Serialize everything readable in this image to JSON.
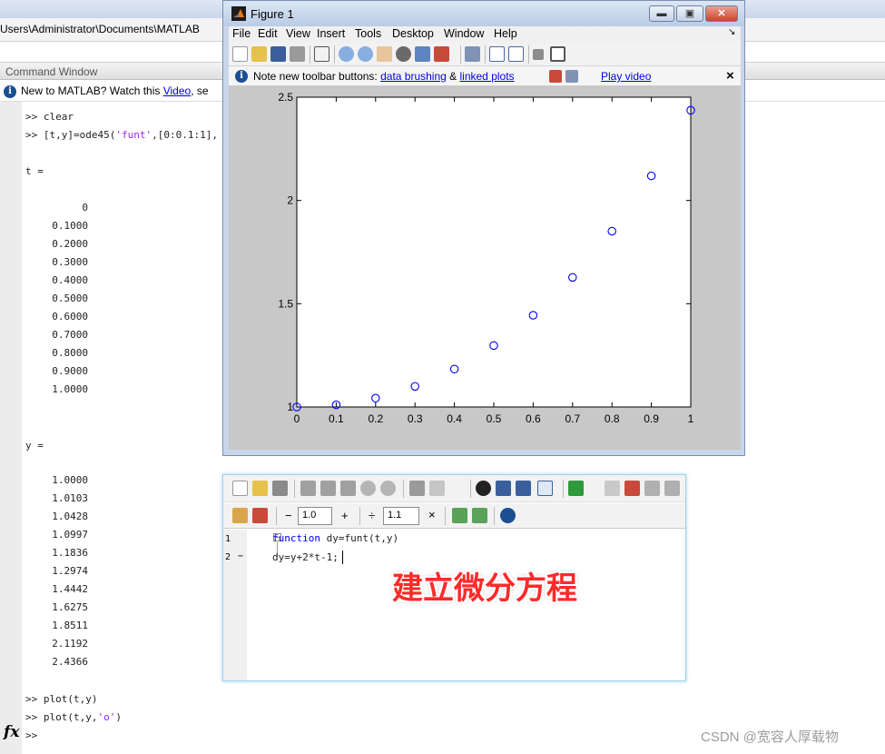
{
  "matlab": {
    "path": "Users\\Administrator\\Documents\\MATLAB",
    "command_window_title": "Command Window",
    "notice": {
      "prefix": "New to MATLAB? Watch this ",
      "link": "Video",
      "suffix": ", se"
    },
    "lines": {
      "l1": ">> clear",
      "l2_prompt": ">> [t,y]=ode45(",
      "l2_str": "'funt'",
      "l2_rest": ",[0:0.1:1],",
      "t_label": "t =",
      "t_values": [
        "0",
        "0.1000",
        "0.2000",
        "0.3000",
        "0.4000",
        "0.5000",
        "0.6000",
        "0.7000",
        "0.8000",
        "0.9000",
        "1.0000"
      ],
      "y_label": "y =",
      "y_values": [
        "1.0000",
        "1.0103",
        "1.0428",
        "1.0997",
        "1.1836",
        "1.2974",
        "1.4442",
        "1.6275",
        "1.8511",
        "2.1192",
        "2.4366"
      ],
      "plot1": ">> plot(t,y)",
      "plot2_prefix": ">> plot(t,y,",
      "plot2_str": "'o'",
      "plot2_suffix": ")",
      "last_prompt": ">>"
    },
    "fx": "fx"
  },
  "figure": {
    "title": "Figure 1",
    "window_buttons": {
      "minimize": "▬",
      "maximize": "▣",
      "close": "✕"
    },
    "menu": [
      "File",
      "Edit",
      "View",
      "Insert",
      "Tools",
      "Desktop",
      "Window",
      "Help"
    ],
    "menu_arrow": "↘",
    "note": {
      "prefix": "Note new toolbar buttons: ",
      "link1": "data brushing",
      "mid": " & ",
      "link2": "linked plots",
      "link3": "Play video",
      "close": "×"
    }
  },
  "chart_data": {
    "type": "scatter",
    "title": "",
    "xlabel": "",
    "ylabel": "",
    "xlim": [
      0,
      1
    ],
    "ylim": [
      1,
      2.5
    ],
    "xticks": [
      "0",
      "0.1",
      "0.2",
      "0.3",
      "0.4",
      "0.5",
      "0.6",
      "0.7",
      "0.8",
      "0.9",
      "1"
    ],
    "yticks": [
      "1",
      "1.5",
      "2",
      "2.5"
    ],
    "marker": "o",
    "color": "#0000ff",
    "grid": false,
    "x": [
      0,
      0.1,
      0.2,
      0.3,
      0.4,
      0.5,
      0.6,
      0.7,
      0.8,
      0.9,
      1.0
    ],
    "y": [
      1.0,
      1.0103,
      1.0428,
      1.0997,
      1.1836,
      1.2974,
      1.4442,
      1.6275,
      1.8511,
      2.1192,
      2.4366
    ]
  },
  "editor": {
    "zoom_minus": "−",
    "zoom_value1": "1.0",
    "zoom_plus": "+",
    "divide": "÷",
    "zoom_value2": "1.1",
    "times": "×",
    "lines": [
      {
        "num": "1",
        "marker": "",
        "keyword": "function",
        "code": " dy=funt(t,y)"
      },
      {
        "num": "2",
        "marker": "−",
        "keyword": "",
        "code": "dy=y+2*t-1;"
      }
    ]
  },
  "caption": "建立微分方程",
  "watermark": "CSDN @宽容人厚载物",
  "colors": {
    "link": "#0000ee",
    "string": "#a020f0",
    "keyword": "#0000ff",
    "caption": "#ff2a2a",
    "marker": "#0000ff"
  }
}
